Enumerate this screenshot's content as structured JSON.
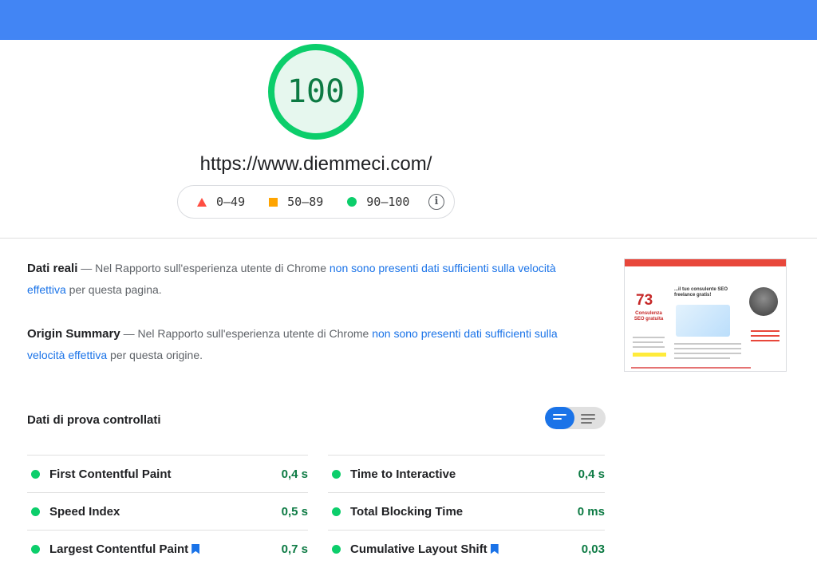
{
  "score": {
    "value": "100",
    "ring_color": "#0cce6b",
    "fill_color": "#e6f7ee",
    "text_color": "#0c7a43",
    "fraction": 1.0
  },
  "url": "https://www.diemmeci.com/",
  "legend": {
    "fail": "0–49",
    "average": "50–89",
    "pass": "90–100",
    "info_icon": "info-icon"
  },
  "field_data": {
    "title": "Dati reali",
    "text_before": " — Nel Rapporto sull'esperienza utente di Chrome ",
    "link": "non sono presenti dati sufficienti sulla velocità effettiva",
    "text_after": " per questa pagina."
  },
  "origin_summary": {
    "title": "Origin Summary",
    "text_before": " — Nel Rapporto sull'esperienza utente di Chrome ",
    "link": "non sono presenti dati sufficienti sulla velocità effettiva",
    "text_after": " per questa origine."
  },
  "thumbnail": {
    "logo": "73",
    "left_label": "Consulenza SEO gratuita",
    "headline": "...il tuo consulente SEO freelance gratis!"
  },
  "lab": {
    "title": "Dati di prova controllati",
    "metrics_left": [
      {
        "name": "First Contentful Paint",
        "value": "0,4 s",
        "bookmark": false
      },
      {
        "name": "Speed Index",
        "value": "0,5 s",
        "bookmark": false
      },
      {
        "name": "Largest Contentful Paint",
        "value": "0,7 s",
        "bookmark": true
      }
    ],
    "metrics_right": [
      {
        "name": "Time to Interactive",
        "value": "0,4 s",
        "bookmark": false
      },
      {
        "name": "Total Blocking Time",
        "value": "0 ms",
        "bookmark": false
      },
      {
        "name": "Cumulative Layout Shift",
        "value": "0,03",
        "bookmark": true
      }
    ]
  },
  "colors": {
    "topbar": "#4285f4",
    "link": "#1a73e8",
    "pass": "#0cce6b",
    "average": "#ffa400",
    "fail": "#ff4e42"
  }
}
